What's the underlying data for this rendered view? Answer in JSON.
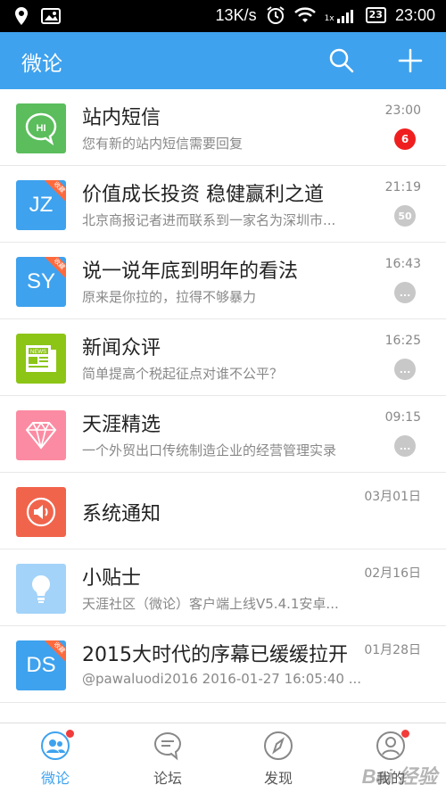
{
  "status_bar": {
    "speed": "13K/s",
    "battery": "23",
    "network": "1x",
    "time": "23:00"
  },
  "app_bar": {
    "title": "微论"
  },
  "colors": {
    "accent": "#3ea2ee",
    "badge_red": "#f01f1f",
    "badge_gray": "#c8c8c8"
  },
  "messages": [
    {
      "title": "站内短信",
      "subtitle": "您有新的站内短信需要回复",
      "time": "23:00",
      "badge": "6",
      "icon": "hi-chat-icon"
    },
    {
      "title": "价值成长投资 稳健赢利之道",
      "subtitle": "北京商报记者进而联系到一家名为深圳市...",
      "time": "21:19",
      "badge": "50",
      "avatar_text": "JZ",
      "ribbon": "收藏"
    },
    {
      "title": "说一说年底到明年的看法",
      "subtitle": "原来是你拉的，拉得不够暴力",
      "time": "16:43",
      "badge": "...",
      "avatar_text": "SY",
      "ribbon": "收藏"
    },
    {
      "title": "新闻众评",
      "subtitle": "简单提高个税起征点对谁不公平？",
      "time": "16:25",
      "badge": "...",
      "icon": "newspaper-icon",
      "icon_text": "NEWS"
    },
    {
      "title": "天涯精选",
      "subtitle": "一个外贸出口传统制造企业的经营管理实录",
      "time": "09:15",
      "badge": "...",
      "icon": "diamond-icon"
    },
    {
      "title": "系统通知",
      "time": "03月01日",
      "icon": "speaker-icon"
    },
    {
      "title": "小贴士",
      "subtitle": "天涯社区（微论）客户端上线V5.4.1安卓...",
      "time": "02月16日",
      "icon": "lightbulb-icon"
    },
    {
      "title": "2015大时代的序幕已缓缓拉开",
      "subtitle": "@pawaluodi2016 2016-01-27 16:05:40 ...",
      "time": "01月28日",
      "avatar_text": "DS",
      "ribbon": "收藏"
    }
  ],
  "tabs": [
    {
      "label": "微论",
      "icon": "people-icon",
      "active": true
    },
    {
      "label": "论坛",
      "icon": "forum-icon"
    },
    {
      "label": "发现",
      "icon": "compass-icon"
    },
    {
      "label": "我的",
      "icon": "user-icon"
    }
  ],
  "watermark": "Bai 经验"
}
